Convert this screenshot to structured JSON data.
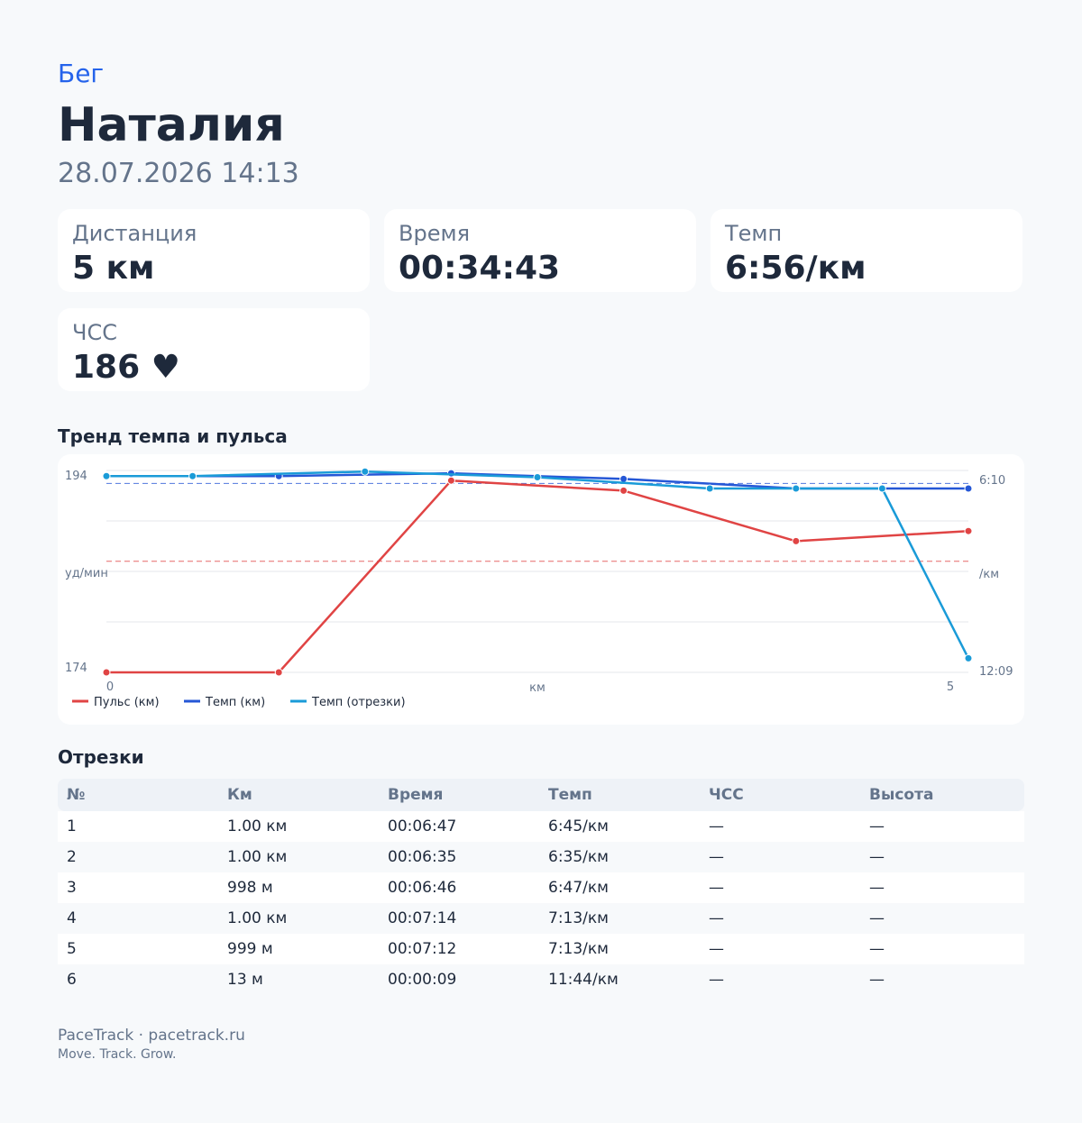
{
  "header": {
    "activity_type": "Бег",
    "athlete_name": "Наталия",
    "date": "28.07.2026 14:13"
  },
  "stats": [
    {
      "label": "Дистанция",
      "value": "5 км"
    },
    {
      "label": "Время",
      "value": "00:34:43"
    },
    {
      "label": "Темп",
      "value": "6:56/км"
    },
    {
      "label": "ЧСС",
      "value": "186 ♥"
    }
  ],
  "chart_section": {
    "title": "Тренд темпа и пульса"
  },
  "chart_data": {
    "type": "line",
    "title": "Тренд темпа и пульса",
    "xlabel": "км",
    "x_tick_labels": [
      "0",
      "5"
    ],
    "y_left": {
      "unit": "уд/мин",
      "top_label": "194",
      "bottom_label": "174",
      "range": [
        174,
        194
      ]
    },
    "y_right": {
      "unit": "/км",
      "top_label": "6:10",
      "bottom_label": "12:09",
      "range_seconds": [
        370,
        729
      ],
      "inverted": true
    },
    "grid": true,
    "legend_position": "bottom-left",
    "series": [
      {
        "name": "Пульс (км)",
        "color": "#e04444",
        "axis": "left",
        "x": [
          0,
          1,
          2,
          3,
          4,
          5
        ],
        "y": [
          174,
          174,
          193,
          192,
          187,
          188
        ],
        "average": 185
      },
      {
        "name": "Темп (км)",
        "color": "#2557d6",
        "axis": "right",
        "x": [
          0,
          1,
          2,
          3,
          4,
          5
        ],
        "y": [
          380,
          380,
          375,
          385,
          402,
          402
        ],
        "average": 393
      },
      {
        "name": "Темп (отрезки)",
        "color": "#1a9bd8",
        "axis": "right",
        "x": [
          0,
          0.5,
          1.5,
          2.5,
          3.5,
          4,
          4.5,
          5
        ],
        "y": [
          380,
          380,
          372,
          382,
          402,
          402,
          402,
          704
        ]
      }
    ]
  },
  "splits": {
    "title": "Отрезки",
    "columns": [
      "№",
      "Км",
      "Время",
      "Темп",
      "ЧСС",
      "Высота"
    ],
    "rows": [
      [
        "1",
        "1.00 км",
        "00:06:47",
        "6:45/км",
        "—",
        "—"
      ],
      [
        "2",
        "1.00 км",
        "00:06:35",
        "6:35/км",
        "—",
        "—"
      ],
      [
        "3",
        "998 м",
        "00:06:46",
        "6:47/км",
        "—",
        "—"
      ],
      [
        "4",
        "1.00 км",
        "00:07:14",
        "7:13/км",
        "—",
        "—"
      ],
      [
        "5",
        "999 м",
        "00:07:12",
        "7:13/км",
        "—",
        "—"
      ],
      [
        "6",
        "13 м",
        "00:00:09",
        "11:44/км",
        "—",
        "—"
      ]
    ]
  },
  "footer": {
    "brand": "PaceTrack · pacetrack.ru",
    "tagline": "Move. Track. Grow."
  }
}
